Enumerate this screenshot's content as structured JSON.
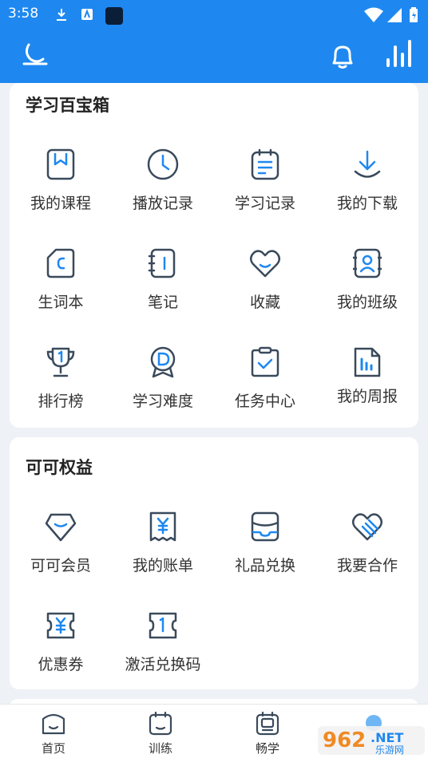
{
  "status_bar": {
    "time": "3:58"
  },
  "toolbox": {
    "title": "学习百宝箱",
    "items": [
      {
        "label": "我的课程",
        "icon": "bookmark-book-icon"
      },
      {
        "label": "播放记录",
        "icon": "clock-icon"
      },
      {
        "label": "学习记录",
        "icon": "notepad-icon"
      },
      {
        "label": "我的下载",
        "icon": "download-icon"
      },
      {
        "label": "生词本",
        "icon": "vocab-book-icon"
      },
      {
        "label": "笔记",
        "icon": "note-icon"
      },
      {
        "label": "收藏",
        "icon": "heart-icon"
      },
      {
        "label": "我的班级",
        "icon": "class-icon"
      },
      {
        "label": "排行榜",
        "icon": "trophy-icon"
      },
      {
        "label": "学习难度",
        "icon": "medal-icon"
      },
      {
        "label": "任务中心",
        "icon": "task-clipboard-icon"
      },
      {
        "label": "我的周报",
        "icon": "weekly-report-icon"
      }
    ]
  },
  "benefits": {
    "title": "可可权益",
    "items": [
      {
        "label": "可可会员",
        "icon": "diamond-icon"
      },
      {
        "label": "我的账单",
        "icon": "bill-icon"
      },
      {
        "label": "礼品兑换",
        "icon": "gift-box-icon"
      },
      {
        "label": "我要合作",
        "icon": "handshake-heart-icon"
      },
      {
        "label": "优惠券",
        "icon": "coupon-icon"
      },
      {
        "label": "激活兑换码",
        "icon": "redeem-code-icon"
      }
    ]
  },
  "tabs": [
    {
      "label": "首页",
      "icon": "home-icon"
    },
    {
      "label": "训练",
      "icon": "training-icon"
    },
    {
      "label": "畅学",
      "icon": "study-icon"
    }
  ],
  "watermark": {
    "text": "962.NET",
    "sub": "乐游网"
  },
  "colors": {
    "primary": "#1e88f0",
    "icon_stroke": "#3a4a5c",
    "accent": "#1e88f0"
  }
}
